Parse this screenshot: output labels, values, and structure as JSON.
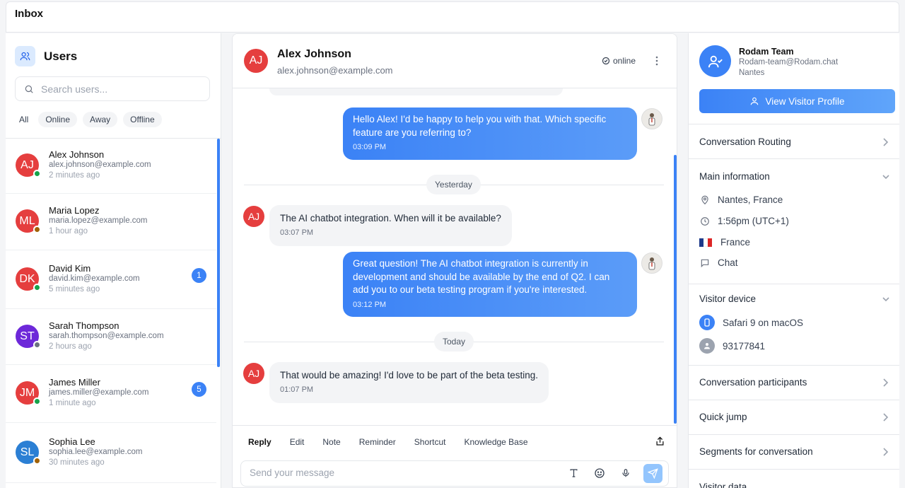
{
  "app": {
    "title": "Inbox"
  },
  "users_panel": {
    "title": "Users",
    "search_placeholder": "Search users...",
    "filters": [
      "All",
      "Online",
      "Away",
      "Offline"
    ],
    "users": [
      {
        "initials": "AJ",
        "name": "Alex Johnson",
        "email": "alex.johnson@example.com",
        "time": "2 minutes ago",
        "avatar_color": "#e53e3e",
        "status": "online",
        "unread": ""
      },
      {
        "initials": "ML",
        "name": "Maria Lopez",
        "email": "maria.lopez@example.com",
        "time": "1 hour ago",
        "avatar_color": "#e53e3e",
        "status": "away",
        "unread": ""
      },
      {
        "initials": "DK",
        "name": "David Kim",
        "email": "david.kim@example.com",
        "time": "5 minutes ago",
        "avatar_color": "#e53e3e",
        "status": "online",
        "unread": "1"
      },
      {
        "initials": "ST",
        "name": "Sarah Thompson",
        "email": "sarah.thompson@example.com",
        "time": "2 hours ago",
        "avatar_color": "#6d28d9",
        "status": "offline",
        "unread": ""
      },
      {
        "initials": "JM",
        "name": "James Miller",
        "email": "james.miller@example.com",
        "time": "1 minute ago",
        "avatar_color": "#e53e3e",
        "status": "online",
        "unread": "5"
      },
      {
        "initials": "SL",
        "name": "Sophia Lee",
        "email": "sophia.lee@example.com",
        "time": "30 minutes ago",
        "avatar_color": "#2b7fd4",
        "status": "away",
        "unread": ""
      }
    ]
  },
  "chat": {
    "contact_initials": "AJ",
    "contact_name": "Alex Johnson",
    "contact_email": "alex.johnson@example.com",
    "status": "online",
    "messages": [
      {
        "dir": "out",
        "text": "Hello Alex! I'd be happy to help you with that. Which specific feature are you referring to?",
        "time": "03:09 PM"
      },
      {
        "dir": "day",
        "text": "Yesterday"
      },
      {
        "dir": "in",
        "text": "The AI chatbot integration. When will it be available?",
        "time": "03:07 PM"
      },
      {
        "dir": "out",
        "text": "Great question! The AI chatbot integration is currently in development and should be available by the end of Q2. I can add you to our beta testing program if you're interested.",
        "time": "03:12 PM"
      },
      {
        "dir": "day",
        "text": "Today"
      },
      {
        "dir": "in",
        "text": "That would be amazing! I'd love to be part of the beta testing.",
        "time": "01:07 PM"
      }
    ],
    "composer_tabs": [
      "Reply",
      "Edit",
      "Note",
      "Reminder",
      "Shortcut",
      "Knowledge Base"
    ],
    "active_tab": "Reply",
    "input_placeholder": "Send your message"
  },
  "visitor_panel": {
    "team_name": "Rodam Team",
    "team_email": "Rodam-team@Rodam.chat",
    "team_city": "Nantes",
    "view_profile_label": "View Visitor Profile",
    "sections": {
      "routing": "Conversation Routing",
      "main_info": "Main information",
      "device": "Visitor device",
      "participants": "Conversation participants",
      "quick_jump": "Quick jump",
      "segments": "Segments for conversation",
      "visitor_data": "Visitor data"
    },
    "main_info": {
      "location": "Nantes, France",
      "local_time": "1:56pm (UTC+1)",
      "country": "France",
      "channel": "Chat"
    },
    "device": {
      "browser": "Safari 9 on macOS",
      "visitor_id": "93177841"
    }
  },
  "colors": {
    "accent": "#3b82f6",
    "online": "#16a34a",
    "away": "#a16207",
    "offline": "#6b7280"
  }
}
